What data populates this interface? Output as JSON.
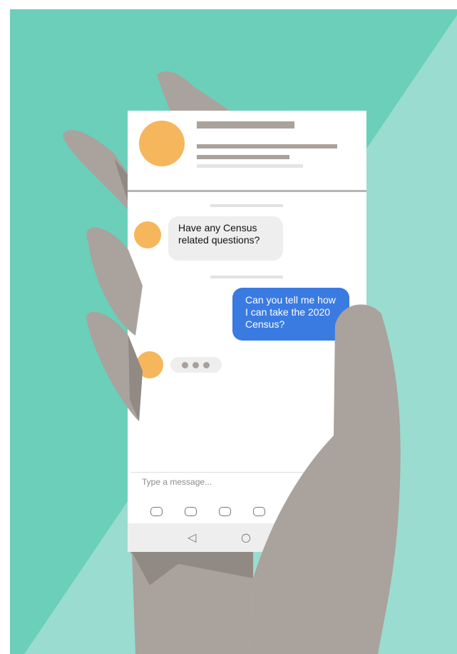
{
  "colors": {
    "background_dark": "#6bcfba",
    "background_light": "#9adccf",
    "hand": "#aaa29c",
    "hand_shadow": "#918983",
    "avatar": "#f6b65b",
    "header_bar": "#aba29c",
    "outgoing_bubble": "#3a7be2",
    "incoming_bubble": "#eeeeee"
  },
  "chat": {
    "incoming_message": "Have any Census related questions?",
    "outgoing_message": "Can you tell me how I can take the 2020 Census?",
    "typing_indicator": "typing"
  },
  "composer": {
    "placeholder": "Type a message..."
  },
  "icons": {
    "toolbar": [
      "app-icon-1",
      "app-icon-2",
      "app-icon-3",
      "app-icon-4"
    ],
    "navbar": [
      "back-icon",
      "home-icon"
    ]
  }
}
